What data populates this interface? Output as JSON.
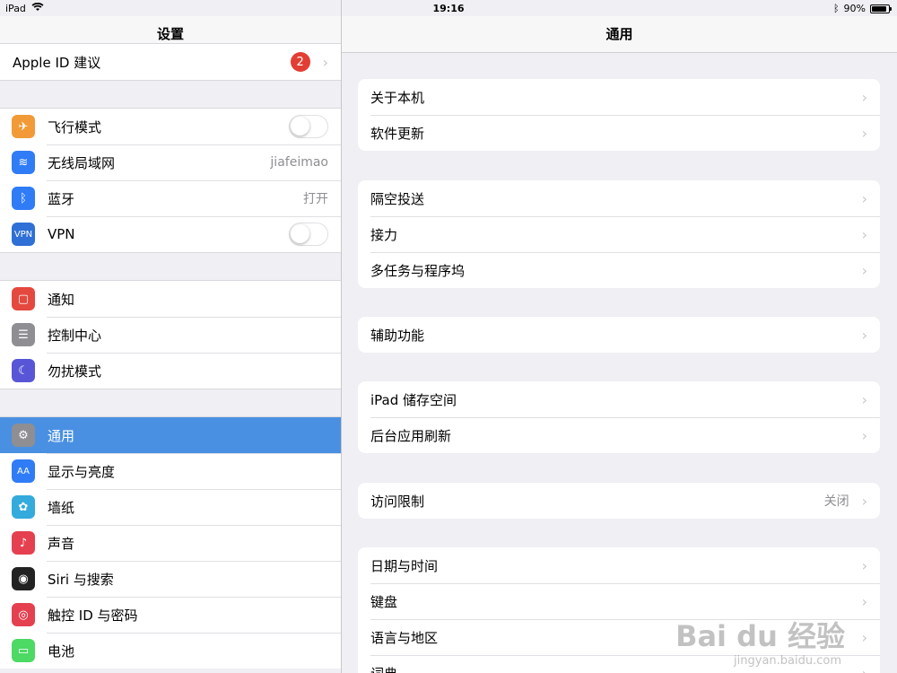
{
  "status": {
    "device": "iPad",
    "time": "19:16",
    "battery": "90%",
    "battery_fraction": 0.9
  },
  "left": {
    "title": "设置",
    "apple_id_row": {
      "label": "Apple ID 建议",
      "badge": "2"
    },
    "group1": [
      {
        "label": "飞行模式",
        "icon": "airplane-icon",
        "color": "#f19a37",
        "control": "toggle"
      },
      {
        "label": "无线局域网",
        "icon": "wifi-icon",
        "color": "#2f7cf6",
        "value": "jiafeimao"
      },
      {
        "label": "蓝牙",
        "icon": "bluetooth-icon",
        "color": "#2f7cf6",
        "value": "打开"
      },
      {
        "label": "VPN",
        "icon": "vpn-icon",
        "color": "#2f6fd6",
        "control": "toggle",
        "icon_text": "VPN"
      }
    ],
    "group2": [
      {
        "label": "通知",
        "icon": "notifications-icon",
        "color": "#e5483e"
      },
      {
        "label": "控制中心",
        "icon": "control-center-icon",
        "color": "#8e8e93"
      },
      {
        "label": "勿扰模式",
        "icon": "moon-icon",
        "color": "#5856d6"
      }
    ],
    "group3": [
      {
        "label": "通用",
        "icon": "gear-icon",
        "color": "#8e8e93",
        "selected": true
      },
      {
        "label": "显示与亮度",
        "icon": "display-icon",
        "color": "#2f7cf6",
        "icon_text": "AA"
      },
      {
        "label": "墙纸",
        "icon": "wallpaper-icon",
        "color": "#35aadc"
      },
      {
        "label": "声音",
        "icon": "sound-icon",
        "color": "#e5404f"
      },
      {
        "label": "Siri 与搜索",
        "icon": "siri-icon",
        "color": "#222"
      },
      {
        "label": "触控 ID 与密码",
        "icon": "fingerprint-icon",
        "color": "#e5404f"
      },
      {
        "label": "电池",
        "icon": "battery-icon",
        "color": "#4cd964"
      }
    ]
  },
  "right": {
    "title": "通用",
    "groups": [
      [
        {
          "label": "关于本机"
        },
        {
          "label": "软件更新"
        }
      ],
      [
        {
          "label": "隔空投送"
        },
        {
          "label": "接力"
        },
        {
          "label": "多任务与程序坞"
        }
      ],
      [
        {
          "label": "辅助功能"
        }
      ],
      [
        {
          "label": "iPad 储存空间"
        },
        {
          "label": "后台应用刷新"
        }
      ],
      [
        {
          "label": "访问限制",
          "value": "关闭"
        }
      ],
      [
        {
          "label": "日期与时间"
        },
        {
          "label": "键盘"
        },
        {
          "label": "语言与地区"
        },
        {
          "label": "词典"
        }
      ]
    ]
  },
  "watermark": {
    "main": "Bai du 经验",
    "sub": "jingyan.baidu.com"
  }
}
